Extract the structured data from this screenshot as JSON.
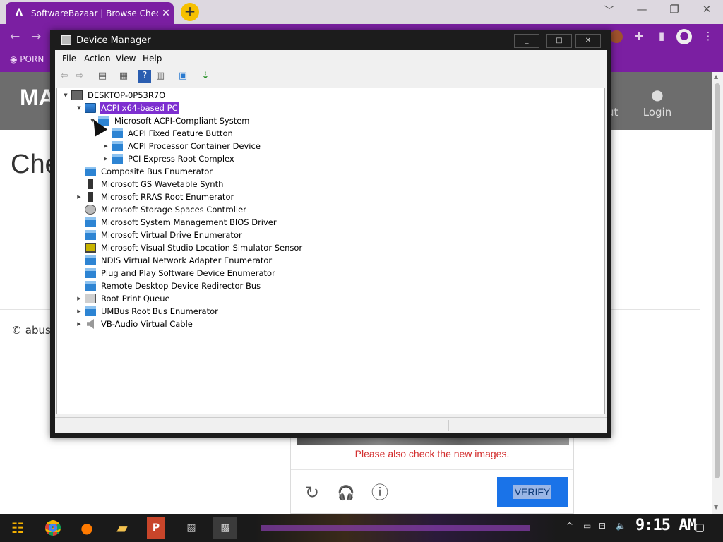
{
  "browser": {
    "tab_title": "SoftwareBazaar | Browse Chec",
    "tab_close": "✕",
    "new_tab": "+",
    "bookmark": "PORN",
    "window_controls": [
      "﹀",
      "—",
      "❐",
      "✕"
    ]
  },
  "site": {
    "brand": "MA",
    "nav_partial": "ut",
    "login": "Login",
    "heading": "Che",
    "footer": "© abuse"
  },
  "captcha": {
    "message": "Please also check the new images.",
    "verify_label": "VERIFY",
    "reload_icon": "↻",
    "audio_icon": "🎧",
    "info_icon": "ⓘ"
  },
  "device_manager": {
    "title": "Device Manager",
    "controls": [
      "_",
      "□",
      "✕"
    ],
    "menu": [
      "File",
      "Action",
      "View",
      "Help"
    ],
    "tree": [
      {
        "label": "DESKTOP-0P53R7O",
        "toggle": "▼",
        "icon": "computer"
      },
      {
        "label": "ACPI x64-based PC",
        "toggle": "▼",
        "icon": "monitor",
        "selected": true
      },
      {
        "label": "Microsoft ACPI-Compliant System",
        "toggle": "▼",
        "icon": "folder"
      },
      {
        "label": "ACPI Fixed Feature Button",
        "toggle": "",
        "icon": "folder"
      },
      {
        "label": "ACPI Processor Container Device",
        "toggle": "▶",
        "icon": "folder"
      },
      {
        "label": "PCI Express Root Complex",
        "toggle": "▶",
        "icon": "folder"
      },
      {
        "label": "Composite Bus Enumerator",
        "toggle": "",
        "icon": "folder"
      },
      {
        "label": "Microsoft GS Wavetable Synth",
        "toggle": "",
        "icon": "dark"
      },
      {
        "label": "Microsoft RRAS Root Enumerator",
        "toggle": "▶",
        "icon": "dark"
      },
      {
        "label": "Microsoft Storage Spaces Controller",
        "toggle": "",
        "icon": "gear"
      },
      {
        "label": "Microsoft System Management BIOS Driver",
        "toggle": "",
        "icon": "folder"
      },
      {
        "label": "Microsoft Virtual Drive Enumerator",
        "toggle": "",
        "icon": "folder"
      },
      {
        "label": "Microsoft Visual Studio Location Simulator Sensor",
        "toggle": "",
        "icon": "sim"
      },
      {
        "label": "NDIS Virtual Network Adapter Enumerator",
        "toggle": "",
        "icon": "folder"
      },
      {
        "label": "Plug and Play Software Device Enumerator",
        "toggle": "",
        "icon": "folder"
      },
      {
        "label": "Remote Desktop Device Redirector Bus",
        "toggle": "",
        "icon": "folder"
      },
      {
        "label": "Root Print Queue",
        "toggle": "▶",
        "icon": "printer"
      },
      {
        "label": "UMBus Root Bus Enumerator",
        "toggle": "▶",
        "icon": "folder"
      },
      {
        "label": "VB-Audio Virtual Cable",
        "toggle": "▶",
        "icon": "speaker"
      }
    ]
  },
  "taskbar": {
    "clock": "9:15 AM",
    "apps": [
      "start",
      "chrome",
      "firefox",
      "file-explorer",
      "powerpoint",
      "photos",
      "device-manager"
    ]
  },
  "colors": {
    "accent_purple": "#7b1fa2",
    "selection_purple": "#7d2fd0",
    "verify_blue": "#1a73e8",
    "error_red": "#d32f2f"
  }
}
